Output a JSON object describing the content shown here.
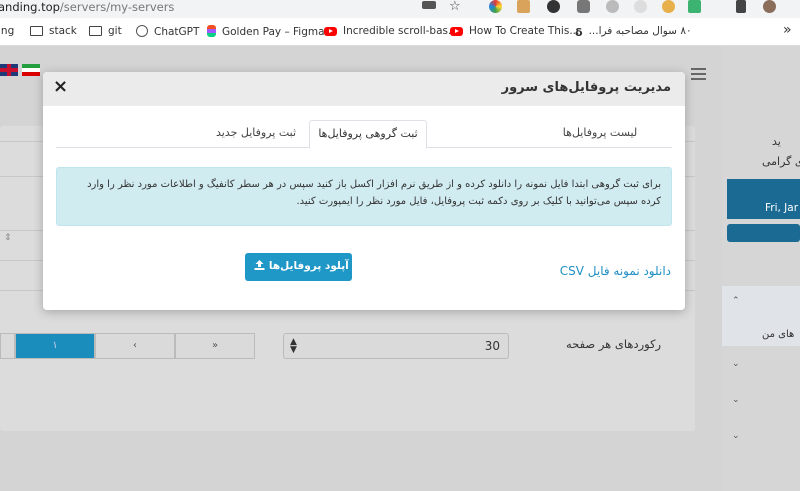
{
  "browser": {
    "url_host": "anding.top",
    "url_path": "/servers/my-servers",
    "bookmarks": [
      {
        "label": "ing"
      },
      {
        "label": "stack"
      },
      {
        "label": "git"
      },
      {
        "label": "ChatGPT"
      },
      {
        "label": "Golden Pay – Figma"
      },
      {
        "label": "Incredible scroll-bas..."
      },
      {
        "label": "How To Create This..."
      },
      {
        "label": "۸۰ سوال مصاحبه فرا..."
      }
    ],
    "overflow_label": "»"
  },
  "page": {
    "pager": [
      "",
      "۱",
      "‹",
      "»"
    ],
    "per_page_value": "30",
    "per_page_label": "رکوردهای هر صفحه",
    "sidebar": {
      "name_fragment": "ی گرامی",
      "date_fragment": "Fri, Jar",
      "greeting_fragment": "ید",
      "menu_fragment": "های من"
    }
  },
  "modal": {
    "title": "مدیریت پروفایل‌های سرور",
    "close_label": "×",
    "tabs": [
      {
        "label": "لیست پروفایل‌ها",
        "active": false
      },
      {
        "label": "ثبت گروهی پروفایل‌ها",
        "active": true
      },
      {
        "label": "ثبت پروفایل جدید",
        "active": false
      }
    ],
    "alert_text": "برای ثبت گروهی ابتدا فایل نمونه را دانلود کرده و از طریق نرم افزار اکسل باز کنید سپس در هر سطر کانفیگ و اطلاعات مورد نظر را وارد کرده سپس می‌توانید با کلیک بر روی دکمه ثبت پروفایل، فایل مورد نظر را ایمپورت کنید.",
    "upload_label": "آپلود پروفایل‌ها",
    "csv_link": "دانلود نمونه فایل CSV"
  },
  "colors": {
    "accent": "#1f97c7",
    "link": "#1f8fc4",
    "alert_bg": "#d1ecf1"
  }
}
